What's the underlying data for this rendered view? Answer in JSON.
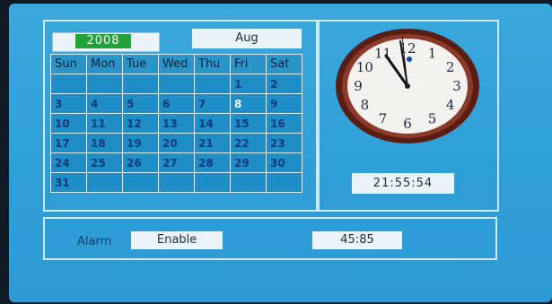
{
  "calendar": {
    "year": "2008",
    "month": "Aug",
    "weekdays": [
      "Sun",
      "Mon",
      "Tue",
      "Wed",
      "Thu",
      "Fri",
      "Sat"
    ],
    "rows": [
      [
        "",
        "",
        "",
        "",
        "",
        "1",
        "2"
      ],
      [
        "3",
        "4",
        "5",
        "6",
        "7",
        "8",
        "9"
      ],
      [
        "10",
        "11",
        "12",
        "13",
        "14",
        "15",
        "16"
      ],
      [
        "17",
        "18",
        "19",
        "20",
        "21",
        "22",
        "23"
      ],
      [
        "24",
        "25",
        "26",
        "27",
        "28",
        "29",
        "30"
      ],
      [
        "31",
        "",
        "",
        "",
        "",
        "",
        ""
      ]
    ],
    "highlighted_day": "8"
  },
  "clock": {
    "numerals": [
      "12",
      "1",
      "2",
      "3",
      "4",
      "5",
      "6",
      "7",
      "8",
      "9",
      "10",
      "11"
    ],
    "time_display": "21:55:54"
  },
  "alarm": {
    "label": "Alarm",
    "status": "Enable",
    "time": "45:85"
  },
  "colors": {
    "screen_blue": "#2f9fd8",
    "year_green": "#21a33a",
    "clock_rim": "#5a1d14",
    "panel_border": "#cfeaf7"
  }
}
